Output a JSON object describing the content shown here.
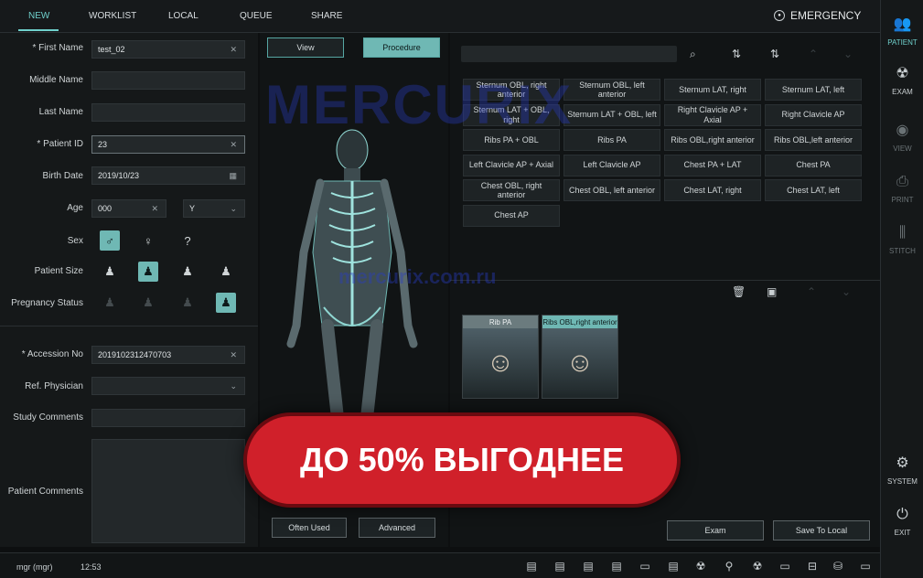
{
  "tabs": [
    "NEW",
    "WORKLIST",
    "LOCAL",
    "QUEUE",
    "SHARE"
  ],
  "emergency": "EMERGENCY",
  "form": {
    "first_name_label": "* First Name",
    "first_name": "test_02",
    "middle_name_label": "Middle Name",
    "last_name_label": "Last Name",
    "patient_id_label": "* Patient ID",
    "patient_id": "23",
    "birth_date_label": "Birth Date",
    "birth_date": "2019/10/23",
    "age_label": "Age",
    "age": "000",
    "age_unit": "Y",
    "sex_label": "Sex",
    "patient_size_label": "Patient Size",
    "pregnancy_label": "Pregnancy Status",
    "accession_label": "* Accession No",
    "accession": "2019102312470703",
    "physician_label": "Ref. Physician",
    "study_comments_label": "Study Comments",
    "patient_comments_label": "Patient Comments"
  },
  "center": {
    "view": "View",
    "procedure": "Procedure",
    "often_used": "Often Used",
    "advanced": "Advanced"
  },
  "procedures": [
    "Sternum OBL, right anterior",
    "Sternum OBL, left anterior",
    "Sternum LAT, right",
    "Sternum LAT, left",
    "Sternum LAT + OBL, right",
    "Sternum LAT + OBL, left",
    "Right Clavicle AP + Axial",
    "Right Clavicle AP",
    "Ribs PA + OBL",
    "Ribs PA",
    "Ribs OBL,right anterior",
    "Ribs OBL,left anterior",
    "Left Clavicle AP + Axial",
    "Left Clavicle AP",
    "Chest PA + LAT",
    "Chest PA",
    "Chest OBL, right anterior",
    "Chest OBL, left anterior",
    "Chest LAT, right",
    "Chest LAT, left",
    "Chest AP"
  ],
  "selected": [
    {
      "label": "Rib PA"
    },
    {
      "label": "Ribs OBL,right anterior"
    }
  ],
  "actions": {
    "exam": "Exam",
    "save": "Save To Local"
  },
  "sidebar": [
    "PATIENT",
    "EXAM",
    "VIEW",
    "PRINT",
    "STITCH",
    "SYSTEM",
    "EXIT"
  ],
  "status": {
    "user": "mgr (mgr)",
    "time": "12:53"
  },
  "watermark": "MERCURIX",
  "watermark_url": "mercurix.com.ru",
  "banner": "ДО 50% ВЫГОДНЕЕ",
  "colors": {
    "accent": "#6fb8b4",
    "banner": "#d0202a"
  }
}
